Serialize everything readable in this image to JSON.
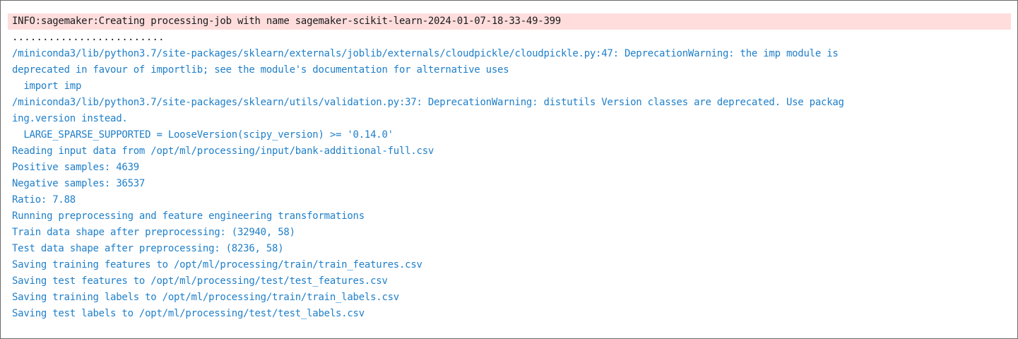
{
  "output": {
    "info_line": "INFO:sagemaker:Creating processing-job with name sagemaker-scikit-learn-2024-01-07-18-33-49-399",
    "progress_dots": ".........................",
    "lines": [
      "/miniconda3/lib/python3.7/site-packages/sklearn/externals/joblib/externals/cloudpickle/cloudpickle.py:47: DeprecationWarning: the imp module is",
      "deprecated in favour of importlib; see the module's documentation for alternative uses",
      "  import imp",
      "/miniconda3/lib/python3.7/site-packages/sklearn/utils/validation.py:37: DeprecationWarning: distutils Version classes are deprecated. Use packag",
      "ing.version instead.",
      "  LARGE_SPARSE_SUPPORTED = LooseVersion(scipy_version) >= '0.14.0'",
      "Reading input data from /opt/ml/processing/input/bank-additional-full.csv",
      "Positive samples: 4639",
      "Negative samples: 36537",
      "Ratio: 7.88",
      "Running preprocessing and feature engineering transformations",
      "Train data shape after preprocessing: (32940, 58)",
      "Test data shape after preprocessing: (8236, 58)",
      "Saving training features to /opt/ml/processing/train/train_features.csv",
      "Saving test features to /opt/ml/processing/test/test_features.csv",
      "Saving training labels to /opt/ml/processing/train/train_labels.csv",
      "Saving test labels to /opt/ml/processing/test/test_labels.csv"
    ]
  },
  "colors": {
    "info_background": "#ffdddd",
    "info_text": "#1a1a1a",
    "stdout_text": "#1f7fc9",
    "border": "#6b6b6b"
  }
}
